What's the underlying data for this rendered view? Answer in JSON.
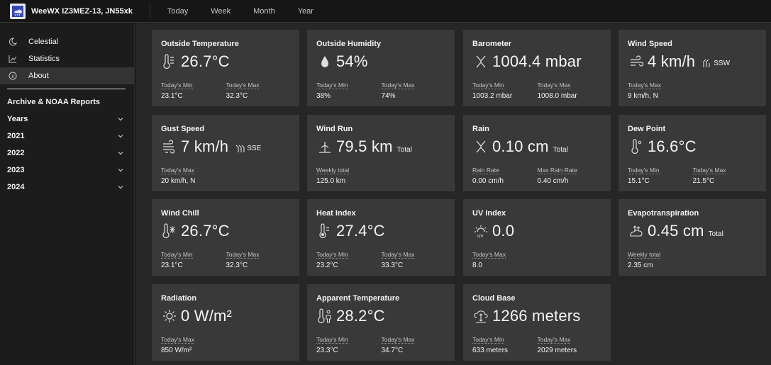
{
  "header": {
    "brand": "WeeWX IZ3MEZ-13, JN55xk",
    "nav": [
      "Today",
      "Week",
      "Month",
      "Year"
    ]
  },
  "sidebar": {
    "links": [
      {
        "label": "Celestial",
        "icon": "moon-icon"
      },
      {
        "label": "Statistics",
        "icon": "chart-icon"
      },
      {
        "label": "About",
        "icon": "info-icon"
      }
    ],
    "archive_heading": "Archive & NOAA Reports",
    "groups": [
      "Years",
      "2021",
      "2022",
      "2023",
      "2024"
    ]
  },
  "tiles": [
    {
      "title": "Outside Temperature",
      "icon": "thermometer-icon",
      "value": "26.7°C",
      "stats": [
        {
          "label": "Today's Min",
          "value": "23.1°C"
        },
        {
          "label": "Today's Max",
          "value": "32.3°C"
        }
      ]
    },
    {
      "title": "Outside Humidity",
      "icon": "droplet-icon",
      "value": "54%",
      "stats": [
        {
          "label": "Today's Min",
          "value": "38%"
        },
        {
          "label": "Today's Max",
          "value": "74%"
        }
      ]
    },
    {
      "title": "Barometer",
      "icon": "barometer-icon",
      "value": "1004.4 mbar",
      "stats": [
        {
          "label": "Today's Min",
          "value": "1003.2 mbar"
        },
        {
          "label": "Today's Max",
          "value": "1008.0 mbar"
        }
      ]
    },
    {
      "title": "Wind Speed",
      "icon": "wind-icon",
      "value": "4 km/h",
      "direction": "SSW",
      "stats": [
        {
          "label": "Today's Max",
          "value": "9 km/h, N"
        }
      ]
    },
    {
      "title": "Gust Speed",
      "icon": "gust-icon",
      "value": "7 km/h",
      "direction": "SSE",
      "stats": [
        {
          "label": "Today's Max",
          "value": "20 km/h, N"
        }
      ]
    },
    {
      "title": "Wind Run",
      "icon": "windmill-icon",
      "value": "79.5 km",
      "suffix": "Total",
      "stats": [
        {
          "label": "Weekly total",
          "value": "125.0 km"
        }
      ]
    },
    {
      "title": "Rain",
      "icon": "rain-icon",
      "value": "0.10 cm",
      "suffix": "Total",
      "stats": [
        {
          "label": "Rain Rate",
          "value": "0.00 cm/h"
        },
        {
          "label": "Max Rain Rate",
          "value": "0.40 cm/h"
        }
      ]
    },
    {
      "title": "Dew Point",
      "icon": "dewpoint-icon",
      "value": "16.6°C",
      "stats": [
        {
          "label": "Today's Min",
          "value": "15.1°C"
        },
        {
          "label": "Today's Max",
          "value": "21.5°C"
        }
      ]
    },
    {
      "title": "Wind Chill",
      "icon": "windchill-icon",
      "value": "26.7°C",
      "stats": [
        {
          "label": "Today's Min",
          "value": "23.1°C"
        },
        {
          "label": "Today's Max",
          "value": "32.3°C"
        }
      ]
    },
    {
      "title": "Heat Index",
      "icon": "heat-index-icon",
      "value": "27.4°C",
      "stats": [
        {
          "label": "Today's Min",
          "value": "23.2°C"
        },
        {
          "label": "Today's Max",
          "value": "33.3°C"
        }
      ]
    },
    {
      "title": "UV Index",
      "icon": "uv-icon",
      "value": "0.0",
      "stats": [
        {
          "label": "Today's Max",
          "value": "8.0"
        }
      ]
    },
    {
      "title": "Evapotranspiration",
      "icon": "evapotranspiration-icon",
      "value": "0.45 cm",
      "suffix": "Total",
      "stats": [
        {
          "label": "Weekly total",
          "value": "2.35 cm"
        }
      ]
    },
    {
      "title": "Radiation",
      "icon": "sun-icon",
      "value": "0 W/m²",
      "stats": [
        {
          "label": "Today's Max",
          "value": "850 W/m²"
        }
      ]
    },
    {
      "title": "Apparent Temperature",
      "icon": "apparent-temp-icon",
      "value": "28.2°C",
      "stats": [
        {
          "label": "Today's Min",
          "value": "23.3°C"
        },
        {
          "label": "Today's Max",
          "value": "34.7°C"
        }
      ]
    },
    {
      "title": "Cloud Base",
      "icon": "cloud-base-icon",
      "value": "1266 meters",
      "stats": [
        {
          "label": "Today's Min",
          "value": "633 meters"
        },
        {
          "label": "Today's Max",
          "value": "2029 meters"
        }
      ]
    }
  ],
  "colors": {
    "tile": "#393939",
    "background": "#262626",
    "header": "#161616"
  }
}
